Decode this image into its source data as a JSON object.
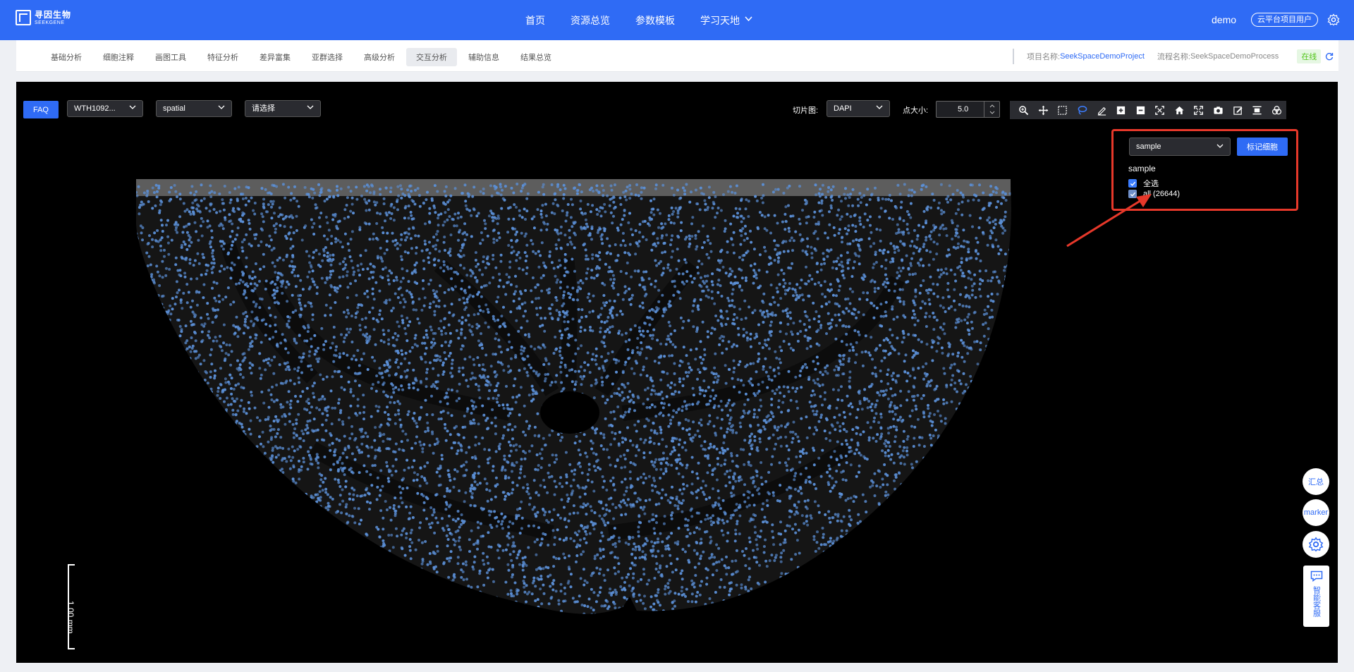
{
  "header": {
    "logo_cn": "寻因生物",
    "logo_en": "SEEKGENE",
    "nav": [
      {
        "label": "首页"
      },
      {
        "label": "资源总览"
      },
      {
        "label": "参数模板"
      },
      {
        "label": "学习天地",
        "dropdown": true
      }
    ],
    "user": "demo",
    "user_role": "云平台项目用户"
  },
  "tabs": [
    "基础分析",
    "细胞注释",
    "画图工具",
    "特征分析",
    "差异富集",
    "亚群选择",
    "高级分析",
    "交互分析",
    "辅助信息",
    "结果总览"
  ],
  "active_tab": "交互分析",
  "project": {
    "project_label": "项目名称:",
    "project_value": "SeekSpaceDemoProject",
    "process_label": "流程名称:",
    "process_value": "SeekSpaceDemoProcess",
    "status": "在线"
  },
  "viewer": {
    "faq": "FAQ",
    "sample_select": "WTH1092...",
    "embedding_select": "spatial",
    "choose_select": "请选择",
    "slice_label": "切片图:",
    "slice_value": "DAPI",
    "point_size_label": "点大小:",
    "point_size": "5.0",
    "tools": [
      "zoom-in-icon",
      "pan-icon",
      "box-select-icon",
      "lasso-icon",
      "draw-icon",
      "zoom-in-square-icon",
      "zoom-out-square-icon",
      "autoscale-icon",
      "home-icon",
      "fullscreen-icon",
      "camera-icon",
      "edit-icon",
      "align-icon",
      "venn-icon"
    ],
    "group_select": "sample",
    "mark_button": "标记细胞",
    "group_title": "sample",
    "select_all": "全选",
    "group_item": "all (26644)",
    "scale_label": "1.00 mm",
    "point_color": "#5b8fd6"
  },
  "float_buttons": {
    "summary": "汇总",
    "marker": "marker",
    "feedback": "智能客服"
  }
}
